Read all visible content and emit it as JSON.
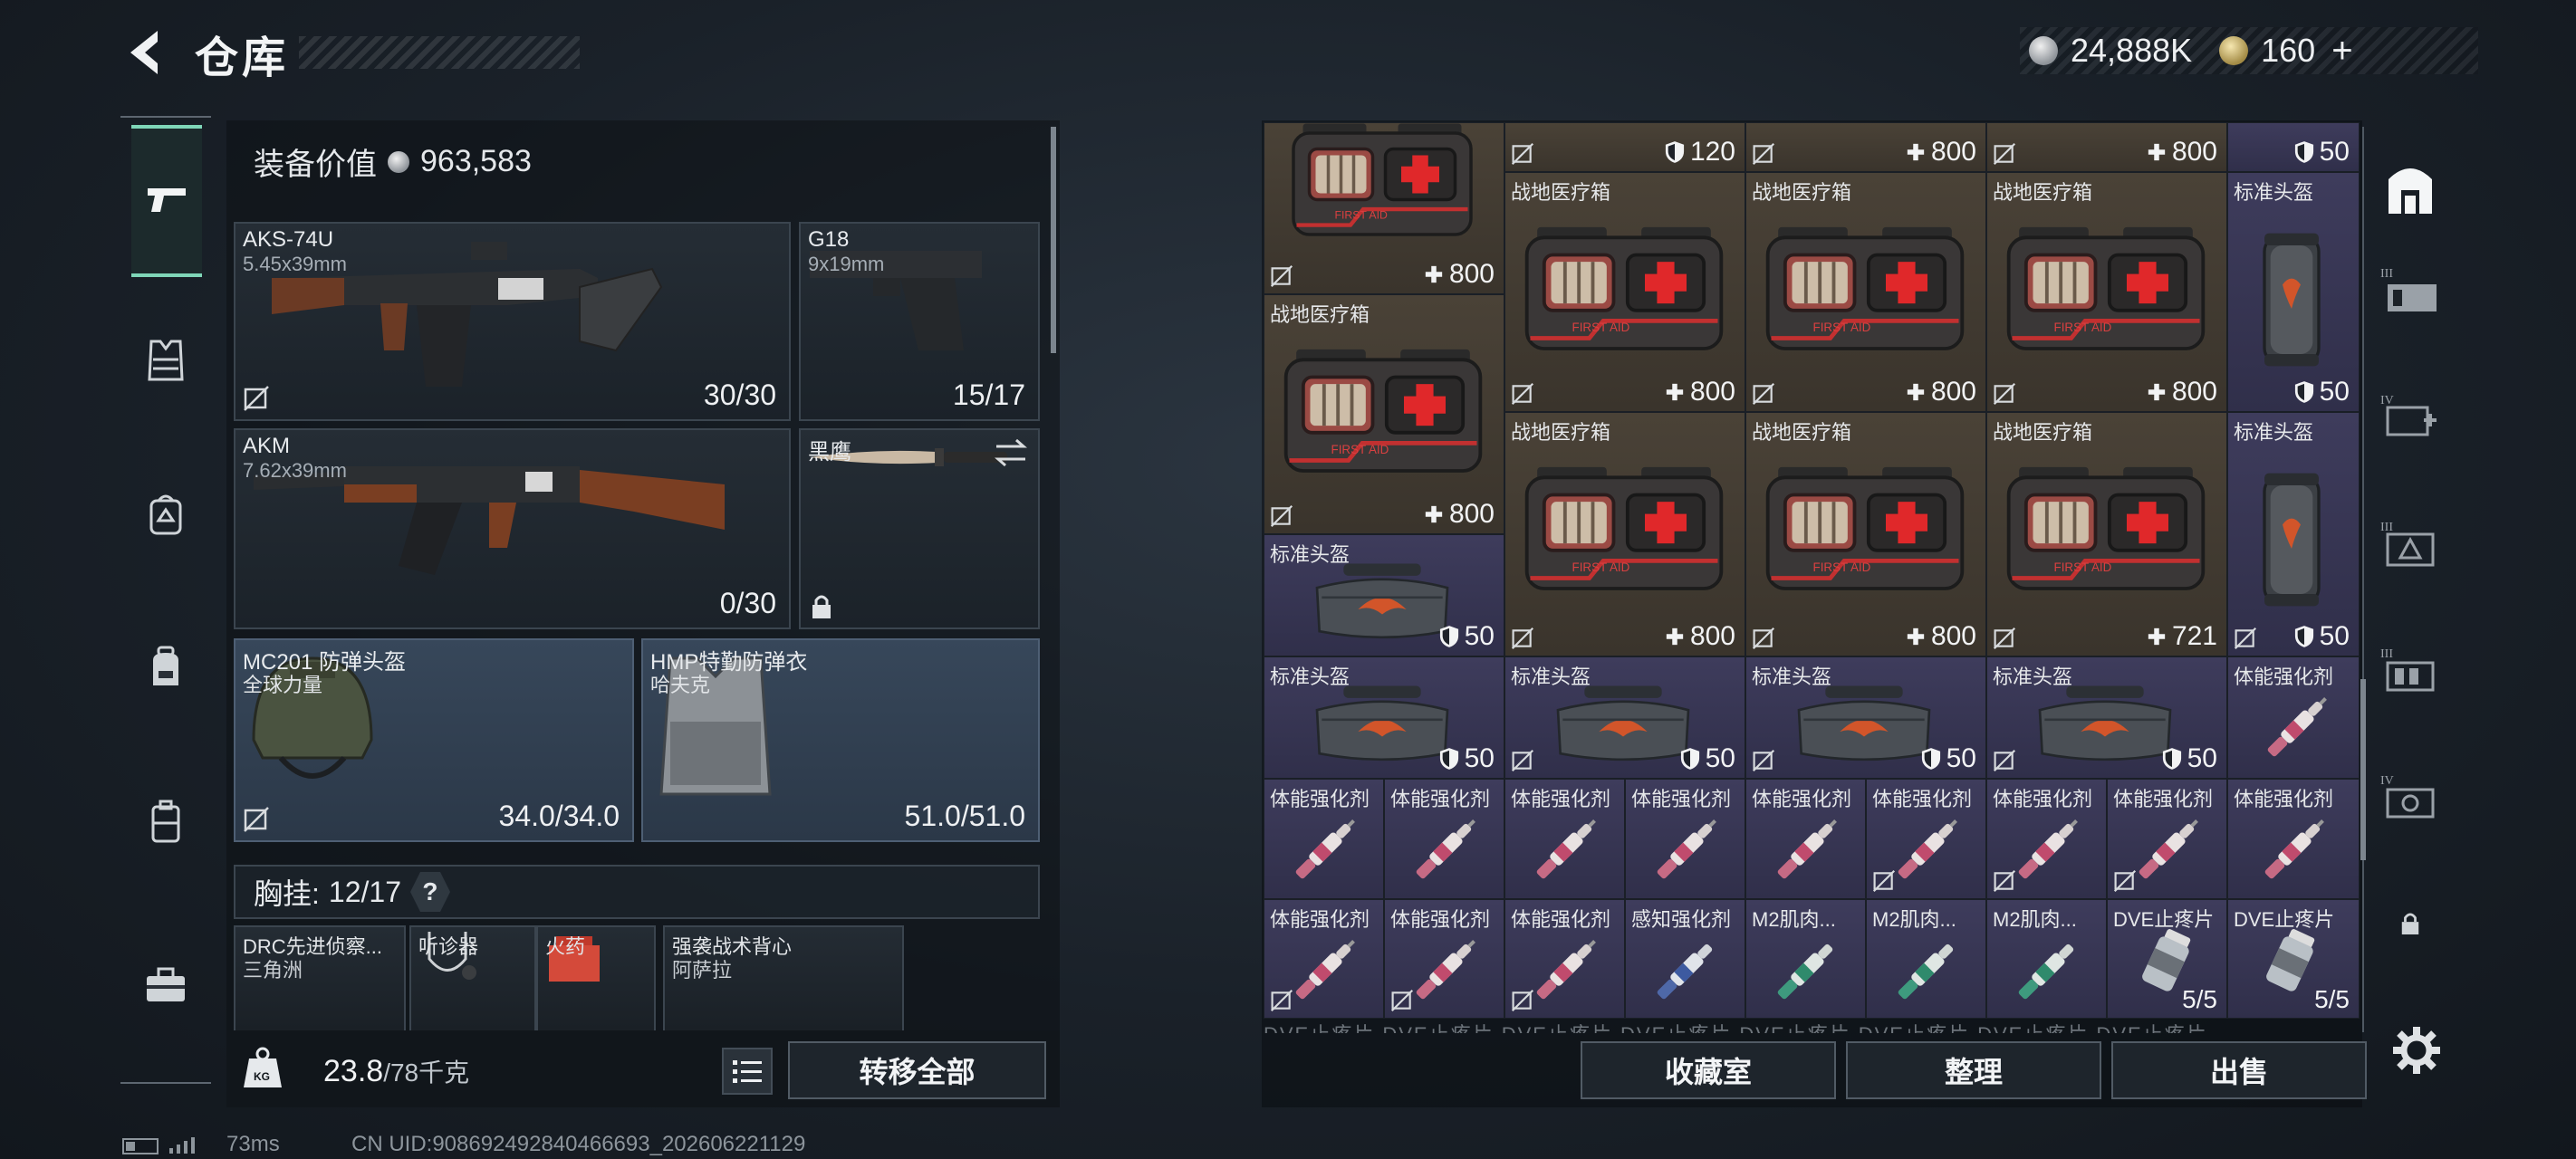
{
  "header": {
    "title": "仓库",
    "silver_amount": "24,888K",
    "gold_amount": "160",
    "add_label": "+"
  },
  "side_tabs": [
    {
      "icon": "pistol-icon",
      "active": true
    },
    {
      "icon": "vest-icon"
    },
    {
      "icon": "backpack-helmet-icon"
    },
    {
      "icon": "backpack-icon"
    },
    {
      "icon": "case-icon"
    },
    {
      "icon": "toolbox-icon"
    }
  ],
  "loadout": {
    "equip_value_label": "装备价值",
    "equip_value": "963,583",
    "primary": {
      "name": "AKS-74U",
      "caliber": "5.45x39mm",
      "ammo": "30/30"
    },
    "sidearm": {
      "name": "G18",
      "caliber": "9x19mm",
      "ammo": "15/17"
    },
    "secondary": {
      "name": "AKM",
      "caliber": "7.62x39mm",
      "ammo": "0/30"
    },
    "melee": {
      "name": "黑鹰"
    },
    "helmet": {
      "name": "MC201 防弹头盔",
      "sub": "全球力量",
      "durability": "34.0/34.0"
    },
    "armor": {
      "name": "HMP特勤防弹衣",
      "sub": "哈夫克",
      "durability": "51.0/51.0"
    },
    "chest_rig_label": "胸挂:",
    "chest_rig_count": "12/17",
    "help_label": "?",
    "rig_slots": [
      {
        "name": "DRC先进侦察...",
        "sub": "三角洲"
      },
      {
        "name": "听诊器",
        "sub": ""
      },
      {
        "name": "火药",
        "sub": ""
      },
      {
        "name": "强袭战术背心",
        "sub": "阿萨拉"
      }
    ],
    "weight_current": "23.8",
    "weight_max": "/78千克",
    "transfer_all_label": "转移全部"
  },
  "storage": {
    "top_row": [
      {
        "value": "",
        "shield": false
      },
      {
        "value": "120",
        "shield": true
      },
      {
        "value": "800",
        "shield": false
      },
      {
        "value": "800",
        "shield": false
      },
      {
        "value": "50",
        "shield": true
      }
    ],
    "med_big_label": "战地医疗箱",
    "helmet_label": "标准头盔",
    "stim_label": "体能强化剂",
    "sense_label": "感知强化剂",
    "m2_label": "M2肌肉...",
    "dve_label": "DVE止疼片",
    "values": {
      "med_800": "800",
      "med_721": "721",
      "helmet_50": "50",
      "dve_count": "5/5"
    },
    "faded_row_text": "DVE止疼片 DVE止疼片 DVE止疼片 DVE止疼片 DVE止疼片 DVE止疼片 DVE止疼片 DVE止疼片"
  },
  "right_tabs": [
    {
      "icon": "storage-home-icon",
      "label": ""
    },
    {
      "icon": "tier3-container-icon",
      "label": "III"
    },
    {
      "icon": "tier4-medical-icon",
      "label": "IV"
    },
    {
      "icon": "tier3-armor-icon",
      "label": "III"
    },
    {
      "icon": "tier3-ammo-icon",
      "label": "III"
    },
    {
      "icon": "tier4-gear-icon",
      "label": "IV"
    },
    {
      "icon": "lock-icon",
      "label": ""
    }
  ],
  "actions": {
    "collection_label": "收藏室",
    "sort_label": "整理",
    "sell_label": "出售"
  },
  "status": {
    "ping": "73ms",
    "uid": "CN UID:908692492840466693_202606221129"
  },
  "colors": {
    "accent": "#7fd6b8",
    "brown_slot": "#4a4237",
    "blue_slot": "#3a4560",
    "purple_slot": "#3e3c5c"
  }
}
